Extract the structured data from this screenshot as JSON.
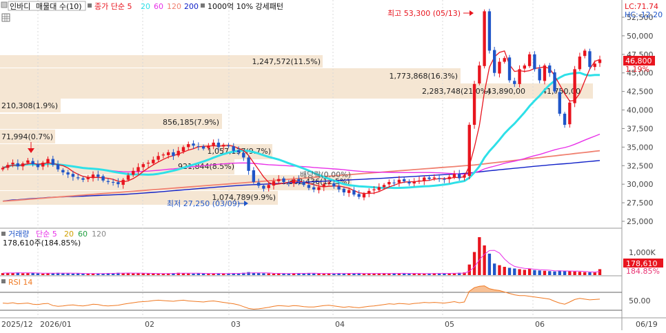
{
  "legend_main": {
    "symbol": "인바디",
    "profile": "매물대 수(10)",
    "price_ma_label": "종가 단순 5",
    "ma_periods": [
      "20",
      "60",
      "120",
      "200"
    ],
    "profile_note": "1000억 10% 강세패턴"
  },
  "legend_volume": {
    "label": "거래량",
    "ma_label": "단순 5",
    "ma_periods": [
      "20",
      "60",
      "120"
    ],
    "last_value": "178,610주(184.85%)"
  },
  "legend_rsi": {
    "label": "RSI 14"
  },
  "corner": {
    "lc": "LC:71.74",
    "hc": "HC:-12.20"
  },
  "price_tag": {
    "value": "46,800",
    "change": "1.19%"
  },
  "volume_tag": {
    "value": "178,610",
    "change": "184.85%"
  },
  "high_label": "최고 53,300 (05/13)",
  "low_label": "최저 27,250 (03/09)",
  "dividend_label": "배당락(0.00%)",
  "colors": {
    "up": "#e8141e",
    "down": "#1f55c8",
    "ma5": "#e8141e",
    "ma20": "#2ee0e8",
    "ma60": "#e830e8",
    "ma120": "#f08070",
    "ma200": "#1020c8",
    "profile": "#f5e6d3",
    "rsi": "#f07820"
  },
  "chart_data": {
    "type": "candlestick",
    "x_dates": [
      "2025/12",
      "2026/01",
      "02",
      "03",
      "04",
      "05",
      "06",
      "06/19"
    ],
    "price_axis": {
      "ticks": [
        "52,500",
        "50,000",
        "47,500",
        "45,000",
        "42,500",
        "40,000",
        "37,500",
        "35,000",
        "32,500",
        "30,000",
        "27,500",
        "25,000"
      ],
      "ylim": [
        25000,
        53300
      ]
    },
    "volume_axis": {
      "ticks": [
        "1,000K"
      ]
    },
    "rsi_axis": {
      "ticks": [
        "50.00"
      ]
    },
    "close_prices": [
      32200,
      32600,
      32900,
      32400,
      32800,
      33200,
      32700,
      32300,
      32900,
      33400,
      32600,
      32000,
      31600,
      31300,
      31000,
      30800,
      30600,
      30900,
      31300,
      31000,
      30500,
      30300,
      30200,
      30000,
      30600,
      31200,
      31800,
      32300,
      32700,
      32900,
      33300,
      33800,
      34000,
      34300,
      33800,
      34500,
      35000,
      35400,
      35200,
      35100,
      34800,
      35200,
      35600,
      35000,
      35300,
      35100,
      34500,
      34300,
      33600,
      31800,
      30300,
      29800,
      29400,
      29900,
      30400,
      30700,
      30300,
      30100,
      30600,
      30400,
      29900,
      29500,
      29300,
      29600,
      30000,
      30200,
      29700,
      29300,
      28900,
      29200,
      28600,
      28300,
      28700,
      29100,
      29300,
      29600,
      29900,
      30300,
      30200,
      30600,
      30400,
      30100,
      30400,
      30500,
      30900,
      30700,
      30900,
      30700,
      30600,
      31000,
      31400,
      30800,
      31200,
      38000,
      43500,
      46000,
      53300,
      48000,
      45000,
      46500,
      47000,
      44000,
      43500,
      45500,
      46000,
      47500,
      45500,
      44000,
      46000,
      45000,
      42500,
      39500,
      38000,
      41000,
      45500,
      47200,
      48000,
      45800,
      46250,
      46800
    ],
    "volume_k": [
      60,
      70,
      65,
      80,
      55,
      60,
      70,
      50,
      45,
      60,
      55,
      70,
      65,
      50,
      45,
      50,
      40,
      45,
      55,
      50,
      45,
      60,
      55,
      70,
      65,
      60,
      50,
      55,
      60,
      50,
      45,
      40,
      50,
      55,
      60,
      70,
      55,
      50,
      45,
      60,
      55,
      40,
      50,
      45,
      55,
      50,
      60,
      45,
      70,
      90,
      65,
      60,
      55,
      50,
      45,
      50,
      55,
      45,
      60,
      50,
      55,
      65,
      50,
      45,
      40,
      55,
      50,
      60,
      45,
      50,
      55,
      60,
      40,
      45,
      50,
      55,
      60,
      45,
      50,
      55,
      60,
      45,
      50,
      40,
      45,
      50,
      60,
      55,
      50,
      45,
      60,
      70,
      80,
      320,
      700,
      1150,
      900,
      650,
      350,
      300,
      250,
      220,
      200,
      180,
      160,
      200,
      150,
      140,
      130,
      120,
      110,
      140,
      130,
      120,
      110,
      100,
      90,
      85,
      80,
      179
    ],
    "rsi_14": [
      45,
      44,
      46,
      43,
      44,
      45,
      42,
      41,
      43,
      44,
      38,
      36,
      37,
      39,
      40,
      38,
      37,
      39,
      42,
      41,
      38,
      37,
      38,
      39,
      42,
      44,
      46,
      48,
      49,
      50,
      52,
      53,
      52,
      51,
      50,
      52,
      53,
      51,
      50,
      49,
      48,
      50,
      51,
      49,
      47,
      45,
      43,
      40,
      35,
      30,
      28,
      29,
      31,
      33,
      36,
      38,
      37,
      36,
      38,
      37,
      35,
      34,
      34,
      36,
      38,
      39,
      37,
      35,
      33,
      35,
      33,
      32,
      34,
      36,
      37,
      39,
      41,
      43,
      42,
      44,
      43,
      42,
      44,
      45,
      47,
      46,
      47,
      46,
      45,
      47,
      49,
      46,
      48,
      78,
      88,
      92,
      93,
      85,
      82,
      80,
      76,
      72,
      68,
      66,
      66,
      64,
      62,
      60,
      58,
      56,
      50,
      45,
      42,
      48,
      55,
      58,
      56,
      54,
      55,
      56
    ],
    "volume_profile": [
      {
        "label": "1,247,572(11.5%)"
      },
      {
        "label": "1,773,868(16.3%)"
      },
      {
        "label": "2,283,748(21.0%)"
      },
      {
        "label": "43,890,00"
      },
      {
        "label": "41,750,00"
      },
      {
        "label": "210,308(1.9%)"
      },
      {
        "label": "856,185(7.9%)"
      },
      {
        "label": "71,994(0.7%)"
      },
      {
        "label": "1,057,137(9.7%)"
      },
      {
        "label": "921,844(8.5%)"
      },
      {
        "label": "1,362,436(12.5%)"
      },
      {
        "label": "1,074,789(9.9%)"
      }
    ]
  }
}
